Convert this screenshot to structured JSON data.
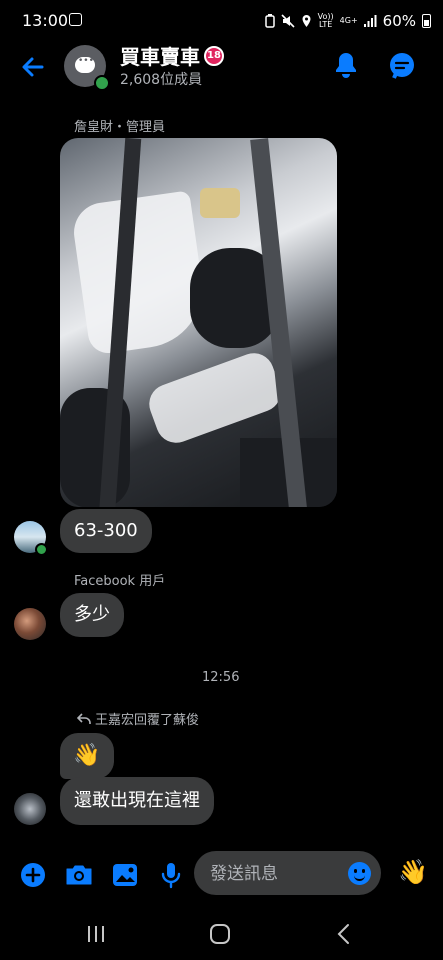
{
  "status_bar": {
    "time": "13:00",
    "volte": "Vo)) LTE",
    "network": "4G+",
    "battery": "60%"
  },
  "header": {
    "group_name": "買車賣車",
    "age_badge": "18",
    "members": "2,608位成員"
  },
  "messages": [
    {
      "sender": "詹皇財・管理員",
      "type": "photo"
    },
    {
      "text": "63-300"
    },
    {
      "sender": "Facebook 用戶",
      "text": "多少"
    }
  ],
  "timestamp": "12:56",
  "reply": {
    "label": "王嘉宏回覆了蘇俊",
    "wave": "👋",
    "text": "還敢出現在這裡"
  },
  "composer": {
    "placeholder": "發送訊息",
    "send_emoji": "👋"
  },
  "colors": {
    "accent": "#0a7cff",
    "bubble": "#3a3b3c",
    "online": "#31a24c",
    "muted": "#b0b3b8"
  }
}
